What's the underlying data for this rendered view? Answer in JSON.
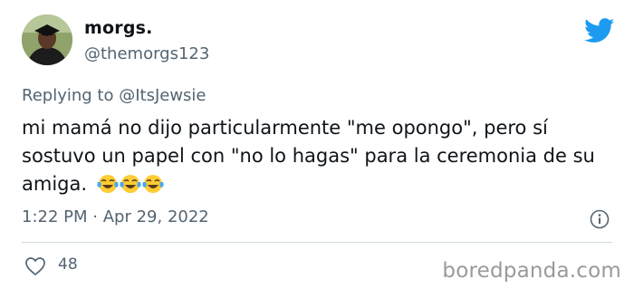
{
  "tweet": {
    "display_name": "morgs.",
    "handle": "@themorgs123",
    "replying_prefix": "Replying to ",
    "replying_to": "@ItsJewsie",
    "text": "mi mamá no dijo particularmente \"me opongo\", pero sí sostuvo un papel con \"no lo hagas\" para la ceremonia de su amiga.",
    "emojis": [
      "face-with-tears-of-joy",
      "face-with-tears-of-joy",
      "face-with-tears-of-joy"
    ],
    "time": "1:22 PM",
    "separator": "·",
    "date": "Apr 29, 2022",
    "like_count": "48"
  },
  "icons": {
    "brand": "twitter-bird-icon",
    "info": "info-icon",
    "like": "heart-icon"
  },
  "watermark": "boredpanda.com",
  "colors": {
    "twitter_blue": "#1d9bf0",
    "secondary_text": "#536471",
    "primary_text": "#0f1419"
  }
}
